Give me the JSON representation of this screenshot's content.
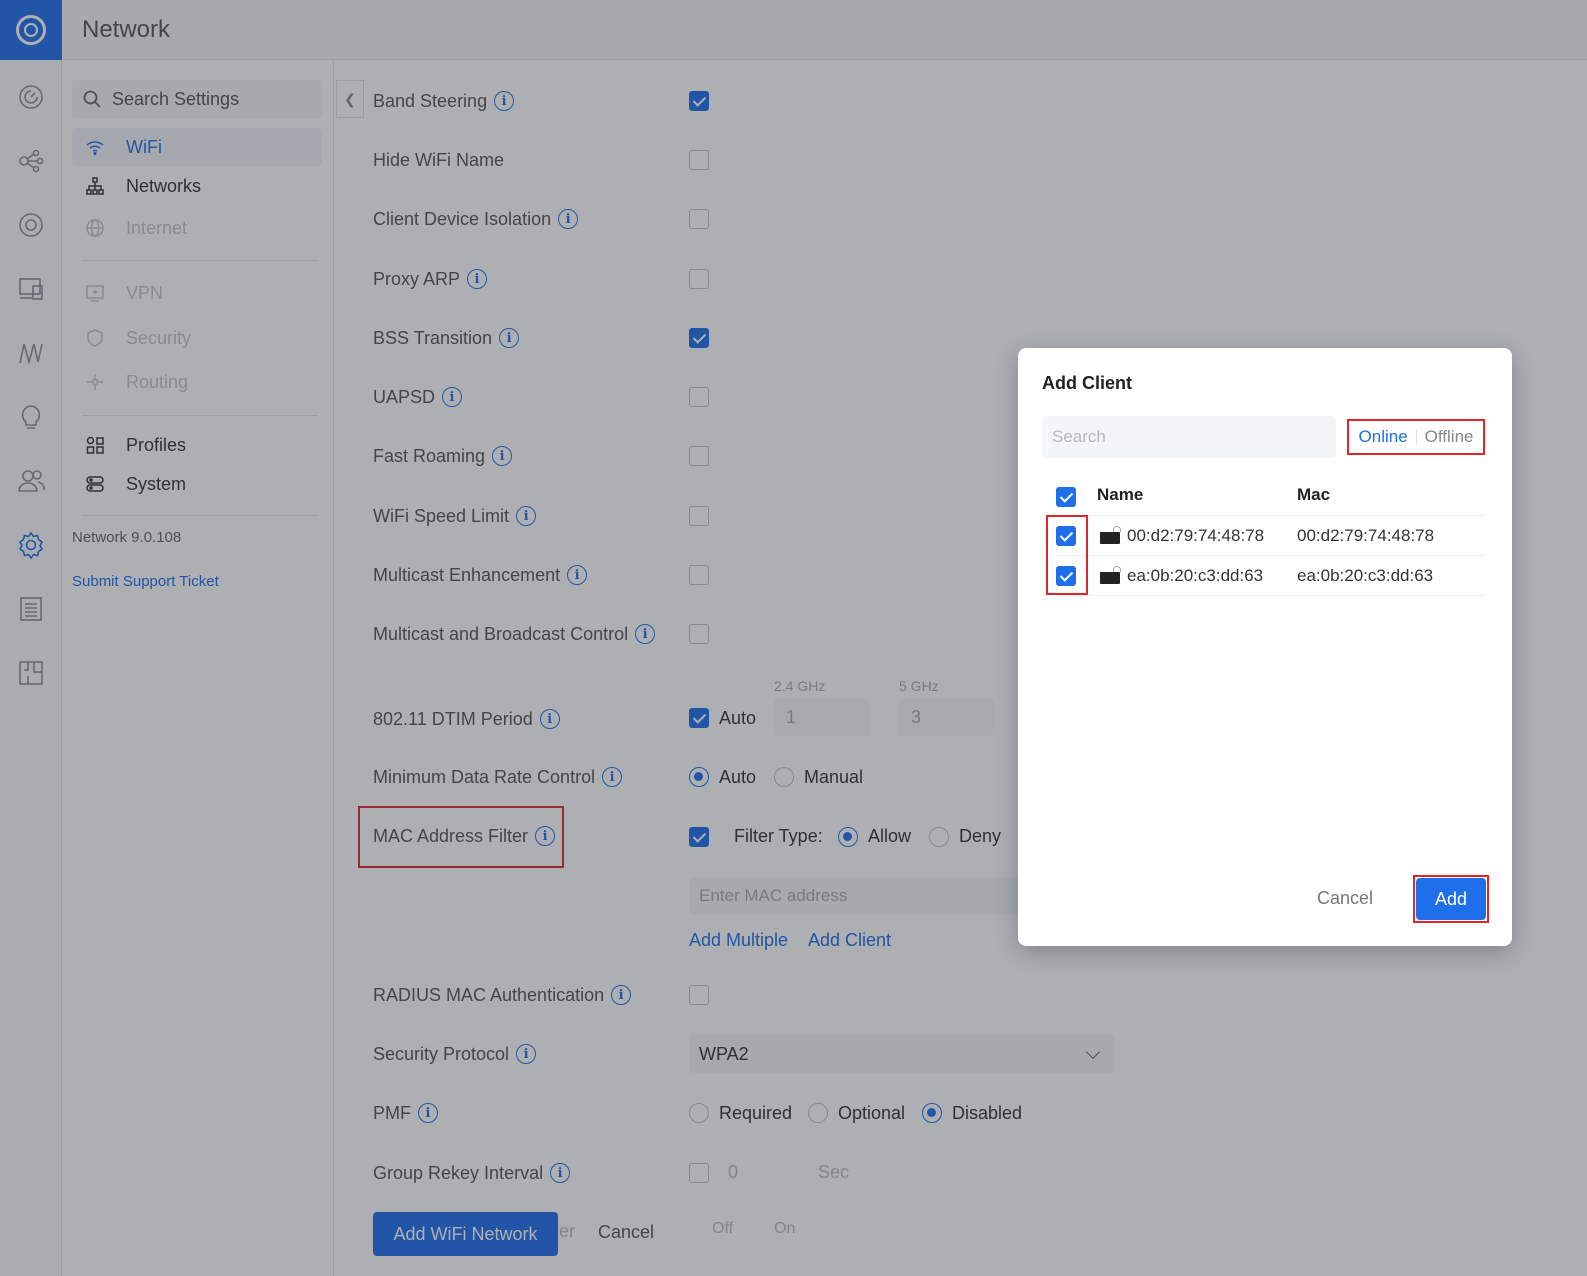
{
  "app": {
    "title": "Network"
  },
  "sidebar": {
    "search_placeholder": "Search Settings",
    "items": [
      {
        "label": "WiFi",
        "icon": "wifi-icon",
        "state": "active"
      },
      {
        "label": "Networks",
        "icon": "networks-icon",
        "state": "normal"
      },
      {
        "label": "Internet",
        "icon": "globe-icon",
        "state": "disabled"
      },
      {
        "label": "VPN",
        "icon": "vpn-icon",
        "state": "disabled"
      },
      {
        "label": "Security",
        "icon": "shield-icon",
        "state": "disabled"
      },
      {
        "label": "Routing",
        "icon": "routing-icon",
        "state": "disabled"
      },
      {
        "label": "Profiles",
        "icon": "profiles-icon",
        "state": "normal"
      },
      {
        "label": "System",
        "icon": "system-icon",
        "state": "normal"
      }
    ],
    "version": "Network 9.0.108",
    "support_link": "Submit Support Ticket"
  },
  "settings": {
    "band_steering": {
      "label": "Band Steering",
      "checked": true
    },
    "hide_wifi_name": {
      "label": "Hide WiFi Name",
      "checked": false
    },
    "client_device_isolation": {
      "label": "Client Device Isolation",
      "checked": false
    },
    "proxy_arp": {
      "label": "Proxy ARP",
      "checked": false
    },
    "bss_transition": {
      "label": "BSS Transition",
      "checked": true
    },
    "uapsd": {
      "label": "UAPSD",
      "checked": false
    },
    "fast_roaming": {
      "label": "Fast Roaming",
      "checked": false
    },
    "wifi_speed_limit": {
      "label": "WiFi Speed Limit",
      "checked": false
    },
    "multicast_enhancement": {
      "label": "Multicast Enhancement",
      "checked": false
    },
    "multicast_broadcast_control": {
      "label": "Multicast and Broadcast Control",
      "checked": false
    },
    "dtim": {
      "label": "802.11 DTIM Period",
      "auto_label": "Auto",
      "auto_checked": true,
      "band_24_label": "2.4 GHz",
      "band_24_value": "1",
      "band_5_label": "5 GHz",
      "band_5_value": "3"
    },
    "min_data_rate": {
      "label": "Minimum Data Rate Control",
      "auto_label": "Auto",
      "manual_label": "Manual",
      "selected": "Auto"
    },
    "mac_filter": {
      "label": "MAC Address Filter",
      "checked": true,
      "filter_type_label": "Filter Type:",
      "allow_label": "Allow",
      "deny_label": "Deny",
      "selected": "Allow",
      "input_placeholder": "Enter MAC address",
      "add_multiple_label": "Add Multiple",
      "add_client_label": "Add Client"
    },
    "radius_mac_auth": {
      "label": "RADIUS MAC Authentication",
      "checked": false
    },
    "security_protocol": {
      "label": "Security Protocol",
      "value": "WPA2"
    },
    "pmf": {
      "label": "PMF",
      "required_label": "Required",
      "optional_label": "Optional",
      "disabled_label": "Disabled",
      "selected": "Disabled"
    },
    "group_rekey": {
      "label": "Group Rekey Interval",
      "value": "0",
      "unit": "Sec"
    },
    "partial_label": "er",
    "toggle_off": "Off",
    "toggle_on": "On",
    "add_network_button": "Add WiFi Network",
    "cancel_button": "Cancel"
  },
  "modal": {
    "title": "Add Client",
    "search_placeholder": "Search",
    "tabs": {
      "online": "Online",
      "offline": "Offline",
      "selected": "Online"
    },
    "columns": {
      "name": "Name",
      "mac": "Mac"
    },
    "select_all": true,
    "rows": [
      {
        "name": "00:d2:79:74:48:78",
        "mac": "00:d2:79:74:48:78",
        "checked": true
      },
      {
        "name": "ea:0b:20:c3:dd:63",
        "mac": "ea:0b:20:c3:dd:63",
        "checked": true
      }
    ],
    "cancel_label": "Cancel",
    "add_label": "Add"
  },
  "colors": {
    "accent": "#1f6feb",
    "highlight": "#e0262b"
  }
}
